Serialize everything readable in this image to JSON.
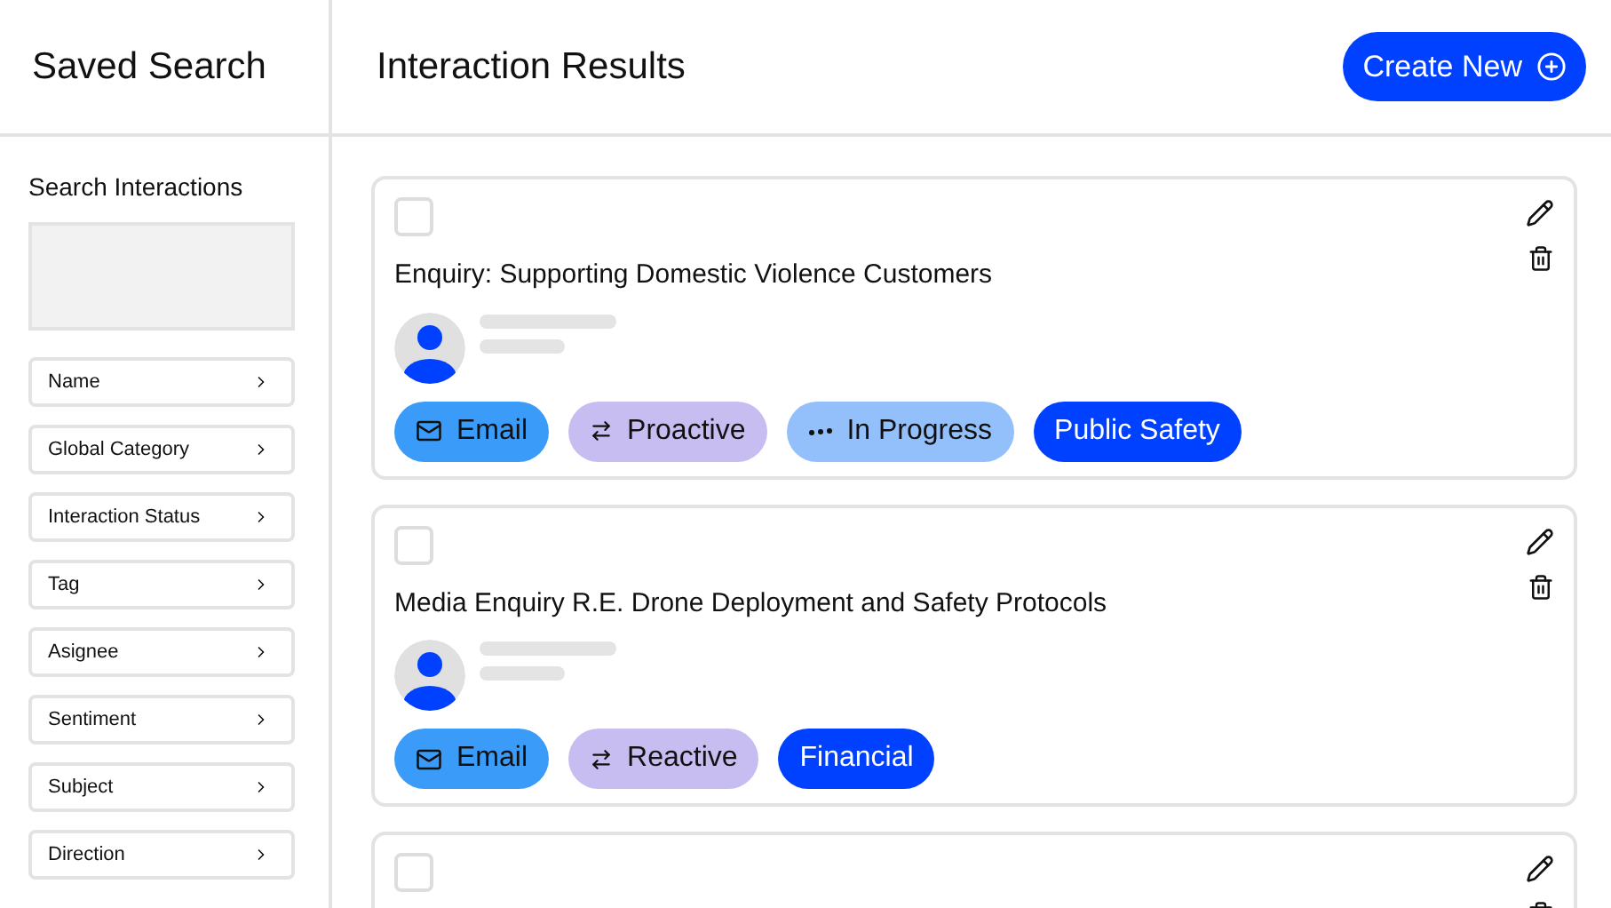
{
  "sidebar": {
    "title": "Saved Search",
    "section_label": "Search Interactions",
    "filters": [
      {
        "label": "Name"
      },
      {
        "label": "Global Category"
      },
      {
        "label": "Interaction Status"
      },
      {
        "label": "Tag"
      },
      {
        "label": "Asignee"
      },
      {
        "label": "Sentiment"
      },
      {
        "label": "Subject"
      },
      {
        "label": "Direction"
      }
    ]
  },
  "main": {
    "title": "Interaction Results",
    "create_button": "Create New"
  },
  "cards": [
    {
      "checked": false,
      "title": "Enquiry: Supporting Domestic Violence Customers",
      "tags": [
        {
          "kind": "channel",
          "label": "Email",
          "color": "#3a9bf9"
        },
        {
          "kind": "direction",
          "label": "Proactive",
          "color": "#c7bdf0"
        },
        {
          "kind": "status",
          "label": "In Progress",
          "color": "#93c0fb"
        },
        {
          "kind": "category",
          "label": "Public Safety",
          "color": "#0041ff"
        }
      ]
    },
    {
      "checked": false,
      "title": "Media Enquiry R.E. Drone Deployment and Safety Protocols",
      "tags": [
        {
          "kind": "channel",
          "label": "Email",
          "color": "#3a9bf9"
        },
        {
          "kind": "direction",
          "label": "Reactive",
          "color": "#c7bdf0"
        },
        {
          "kind": "category",
          "label": "Financial",
          "color": "#0041ff"
        }
      ]
    },
    {
      "checked": false
    }
  ]
}
